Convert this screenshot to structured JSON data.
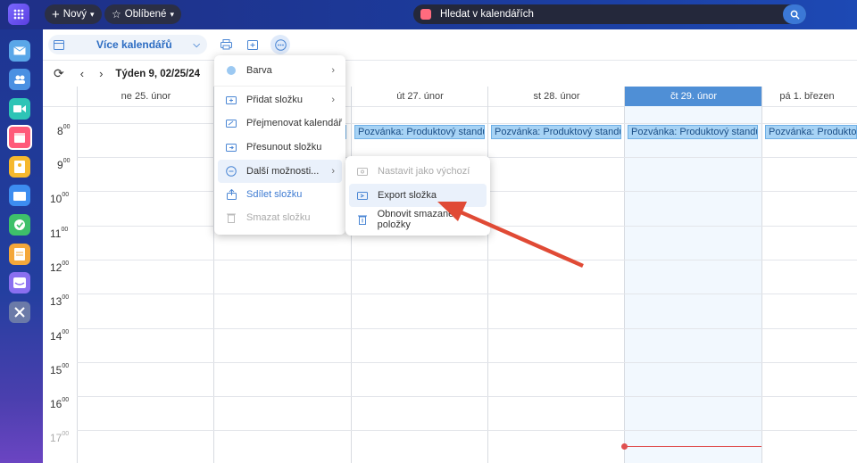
{
  "topbar": {
    "new_label": "Nový",
    "favorites_label": "Oblíbené",
    "search_placeholder": "Hledat v kalendářích"
  },
  "toolbar": {
    "calendar_selector": "Více kalendářů"
  },
  "nav": {
    "week_label": "Týden 9, 02/25/24"
  },
  "days": [
    {
      "label": "ne 25. únor",
      "today": false
    },
    {
      "label": "",
      "today": false
    },
    {
      "label": "út 27. únor",
      "today": false
    },
    {
      "label": "st 28. únor",
      "today": false
    },
    {
      "label": "čt 29. únor",
      "today": true
    },
    {
      "label": "pá 1. březen",
      "today": false
    }
  ],
  "hours": [
    {
      "h": "8",
      "m": "00"
    },
    {
      "h": "9",
      "m": "00"
    },
    {
      "h": "10",
      "m": "00"
    },
    {
      "h": "11",
      "m": "00"
    },
    {
      "h": "12",
      "m": "00"
    },
    {
      "h": "13",
      "m": "00"
    },
    {
      "h": "14",
      "m": "00"
    },
    {
      "h": "15",
      "m": "00"
    },
    {
      "h": "16",
      "m": "00"
    },
    {
      "h": "17",
      "m": "00"
    }
  ],
  "event_title": "Pozvánka: Produktový standup -",
  "context_menu": {
    "items": [
      {
        "label": "Barva",
        "icon": "color-dot-icon",
        "submenu": true,
        "disabled": false
      },
      {
        "label": "Přidat složku",
        "icon": "folder-add-icon",
        "submenu": true,
        "disabled": false
      },
      {
        "label": "Přejmenovat kalendář",
        "icon": "folder-rename-icon",
        "submenu": false,
        "disabled": false
      },
      {
        "label": "Přesunout složku",
        "icon": "folder-move-icon",
        "submenu": false,
        "disabled": false
      },
      {
        "label": "Další možnosti...",
        "icon": "more-options-icon",
        "submenu": true,
        "disabled": false
      },
      {
        "label": "Sdílet složku",
        "icon": "share-icon",
        "submenu": false,
        "disabled": false
      },
      {
        "label": "Smazat složku",
        "icon": "trash-icon",
        "submenu": false,
        "disabled": true
      }
    ]
  },
  "submenu": {
    "items": [
      {
        "label": "Nastavit jako výchozí",
        "icon": "folder-default-icon",
        "disabled": true
      },
      {
        "label": "Export složka",
        "icon": "folder-export-icon",
        "disabled": false
      },
      {
        "label": "Obnovit smazané položky",
        "icon": "restore-icon",
        "disabled": false
      }
    ]
  },
  "colors": {
    "accent": "#3d7ad1",
    "today_header": "#4f8fd6",
    "event_bg": "#a7d3f5",
    "arrow": "#e04a35"
  }
}
